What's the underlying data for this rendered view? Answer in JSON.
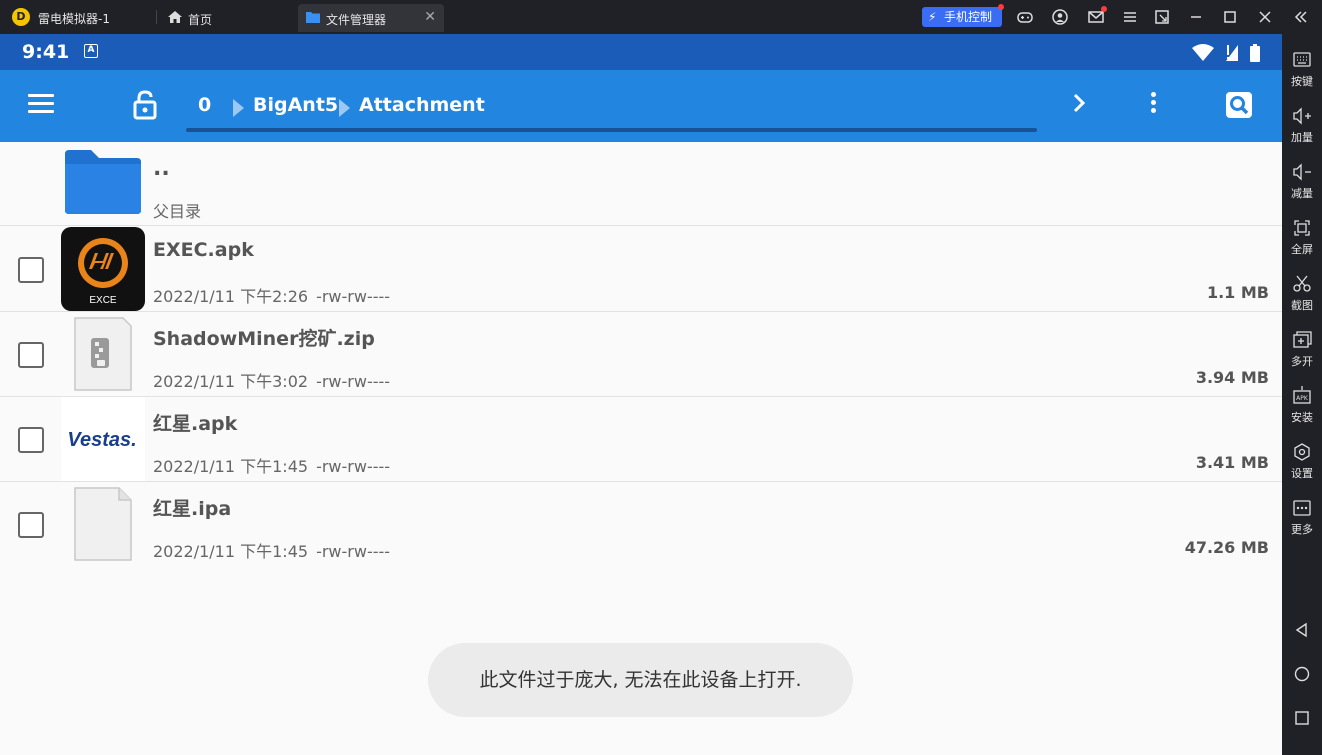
{
  "titlebar": {
    "app_logo": "D",
    "app_title": "雷电模拟器-1",
    "tabs": [
      {
        "label": "首页",
        "icon": "home-icon"
      },
      {
        "label": "文件管理器",
        "icon": "folder-icon",
        "close": "✕"
      }
    ],
    "phone_control": "手机控制",
    "window_icons": [
      "gamepad-icon",
      "user-icon",
      "mail-icon",
      "menu-icon",
      "popout-icon",
      "minimize-icon",
      "maximize-icon",
      "close-icon",
      "collapse-icon"
    ]
  },
  "sidebar": {
    "items": [
      {
        "label": "按键",
        "icon": "keyboard-icon"
      },
      {
        "label": "加量",
        "icon": "volume-up-icon"
      },
      {
        "label": "减量",
        "icon": "volume-down-icon"
      },
      {
        "label": "全屏",
        "icon": "fullscreen-icon"
      },
      {
        "label": "截图",
        "icon": "scissors-icon"
      },
      {
        "label": "多开",
        "icon": "multi-open-icon"
      },
      {
        "label": "安装",
        "icon": "apk-install-icon"
      },
      {
        "label": "设置",
        "icon": "settings-icon"
      },
      {
        "label": "更多",
        "icon": "more-icon"
      }
    ],
    "nav": [
      "back-icon",
      "home-circle-icon",
      "recents-icon"
    ]
  },
  "statusbar": {
    "time": "9:41",
    "a_badge": "A"
  },
  "appbar": {
    "breadcrumbs": [
      "0",
      "BigAnt5",
      "Attachment"
    ],
    "accent": "#2286e0",
    "status_color": "#1a5cb8"
  },
  "files": {
    "parent": {
      "name": "..",
      "label": "父目录"
    },
    "items": [
      {
        "name": "EXEC.apk",
        "date": "2022/1/11 下午2:26",
        "perm": "-rw-rw----",
        "size": "1.1 MB",
        "thumb": "exec-app-icon",
        "thumb_text": "EXCE"
      },
      {
        "name": "ShadowMiner挖矿.zip",
        "date": "2022/1/11 下午3:02",
        "perm": "-rw-rw----",
        "size": "3.94 MB",
        "thumb": "zip-file-icon"
      },
      {
        "name": "红星.apk",
        "date": "2022/1/11 下午1:45",
        "perm": "-rw-rw----",
        "size": "3.41 MB",
        "thumb": "vestas-app-icon",
        "thumb_text": "Vestas."
      },
      {
        "name": "红星.ipa",
        "date": "2022/1/11 下午1:45",
        "perm": "-rw-rw----",
        "size": "47.26 MB",
        "thumb": "generic-file-icon"
      }
    ]
  },
  "toast": "此文件过于庞大, 无法在此设备上打开."
}
